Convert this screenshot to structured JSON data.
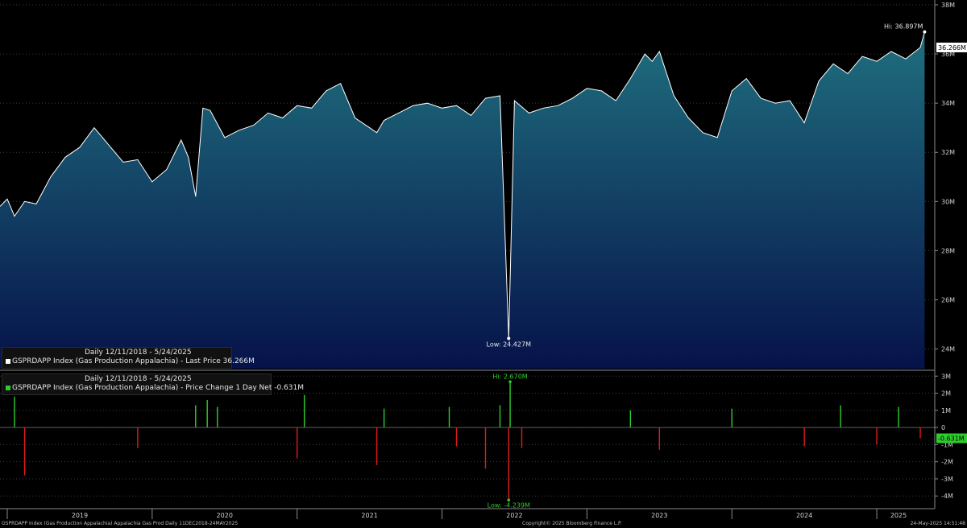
{
  "footer": {
    "left": "GSPRDAPP Index (Gas Production Appalachia) Appalachia Gas Prod  Daily 11DEC2018-24MAY2025",
    "center": "Copyright© 2025 Bloomberg Finance L.P.",
    "right": "24-May-2025 14:51:48"
  },
  "colors": {
    "background": "#000000",
    "price_line": "#ffffff",
    "area_top": "#1f6f7e",
    "area_bottom": "#06124a",
    "positive_bar": "#2ecc2e",
    "negative_bar": "#e01b1b",
    "grid": "#3c3c3c",
    "last_value_bg": "#ffffff",
    "change_last_bg": "#2ecc2e"
  },
  "chart_data": [
    {
      "type": "area",
      "panel": "top",
      "legend_range": "Daily 12/11/2018 - 5/24/2025",
      "legend_label": "GSPRDAPP Index (Gas Production Appalachia) - Last Price 36.266M",
      "y_unit": "M",
      "ylim": [
        23.2,
        38.0
      ],
      "y_ticks": [
        "24M",
        "26M",
        "28M",
        "30M",
        "32M",
        "34M",
        "36M",
        "38M"
      ],
      "y_tick_values": [
        24,
        26,
        28,
        30,
        32,
        34,
        36,
        38
      ],
      "grid": true,
      "last_value_label": "36.266M",
      "last_value": 36.266,
      "high_label": "Hi: 36.897M",
      "high_value": 36.897,
      "high_year": 2025.33,
      "low_label": "Low: 24.427M",
      "low_value": 24.427,
      "low_year": 2022.46,
      "x_years": [
        2018.95,
        2019.0,
        2019.05,
        2019.12,
        2019.2,
        2019.3,
        2019.4,
        2019.5,
        2019.6,
        2019.7,
        2019.8,
        2019.9,
        2020.0,
        2020.1,
        2020.2,
        2020.25,
        2020.3,
        2020.35,
        2020.4,
        2020.5,
        2020.6,
        2020.7,
        2020.8,
        2020.9,
        2021.0,
        2021.1,
        2021.2,
        2021.3,
        2021.4,
        2021.5,
        2021.55,
        2021.6,
        2021.7,
        2021.8,
        2021.9,
        2022.0,
        2022.1,
        2022.2,
        2022.3,
        2022.4,
        2022.46,
        2022.5,
        2022.6,
        2022.7,
        2022.8,
        2022.9,
        2023.0,
        2023.1,
        2023.2,
        2023.3,
        2023.4,
        2023.45,
        2023.5,
        2023.6,
        2023.7,
        2023.8,
        2023.9,
        2024.0,
        2024.1,
        2024.2,
        2024.3,
        2024.4,
        2024.5,
        2024.6,
        2024.7,
        2024.8,
        2024.9,
        2025.0,
        2025.1,
        2025.2,
        2025.3,
        2025.33
      ],
      "values": [
        29.8,
        30.1,
        29.4,
        30.0,
        29.9,
        31.0,
        31.8,
        32.2,
        33.0,
        32.3,
        31.6,
        31.7,
        30.8,
        31.3,
        32.5,
        31.8,
        30.2,
        33.8,
        33.7,
        32.6,
        32.9,
        33.1,
        33.6,
        33.4,
        33.9,
        33.8,
        34.5,
        34.8,
        33.4,
        33.0,
        32.8,
        33.3,
        33.6,
        33.9,
        34.0,
        33.8,
        33.9,
        33.5,
        34.2,
        34.3,
        24.427,
        34.1,
        33.6,
        33.8,
        33.9,
        34.2,
        34.6,
        34.5,
        34.1,
        35.0,
        36.0,
        35.7,
        36.1,
        34.3,
        33.4,
        32.8,
        32.6,
        34.5,
        35.0,
        34.2,
        34.0,
        34.1,
        33.2,
        34.9,
        35.6,
        35.2,
        35.9,
        35.7,
        36.1,
        35.8,
        36.266,
        36.897
      ]
    },
    {
      "type": "bar",
      "panel": "bottom",
      "legend_range": "Daily 12/11/2018 - 5/24/2025",
      "legend_label": "GSPRDAPP Index (Gas Production Appalachia) - Price Change 1 Day Net -0.631M",
      "y_unit": "M",
      "ylim": [
        -4.6,
        3.2
      ],
      "y_ticks": [
        "-4M",
        "-3M",
        "-2M",
        "-1M",
        "0",
        "1M",
        "2M",
        "3M"
      ],
      "y_tick_values": [
        -4,
        -3,
        -2,
        -1,
        0,
        1,
        2,
        3
      ],
      "grid": true,
      "last_value_label": "-0.631M",
      "last_value": -0.631,
      "high_label": "Hi: 2.670M",
      "high_value": 2.67,
      "high_year": 2022.47,
      "low_label": "Low: -4.239M",
      "low_value": -4.239,
      "low_year": 2022.46,
      "x_years": [
        2019.05,
        2019.12,
        2019.9,
        2020.3,
        2020.38,
        2020.45,
        2021.0,
        2021.05,
        2021.55,
        2021.6,
        2022.05,
        2022.1,
        2022.3,
        2022.4,
        2022.46,
        2022.47,
        2022.55,
        2023.3,
        2023.5,
        2024.0,
        2024.5,
        2024.75,
        2025.0,
        2025.15,
        2025.3
      ],
      "values": [
        1.8,
        -2.8,
        -1.2,
        1.3,
        1.6,
        1.2,
        -1.8,
        1.9,
        -2.2,
        1.1,
        1.2,
        -1.1,
        -2.4,
        1.3,
        -4.239,
        2.67,
        -1.2,
        1.0,
        -1.3,
        1.1,
        -1.1,
        1.3,
        -1.0,
        1.2,
        -0.631
      ]
    }
  ],
  "x_axis": {
    "labels": [
      "2019",
      "2020",
      "2021",
      "2022",
      "2023",
      "2024",
      "2025"
    ],
    "label_years": [
      2019.5,
      2020.5,
      2021.5,
      2022.5,
      2023.5,
      2024.5,
      2025.15
    ]
  }
}
